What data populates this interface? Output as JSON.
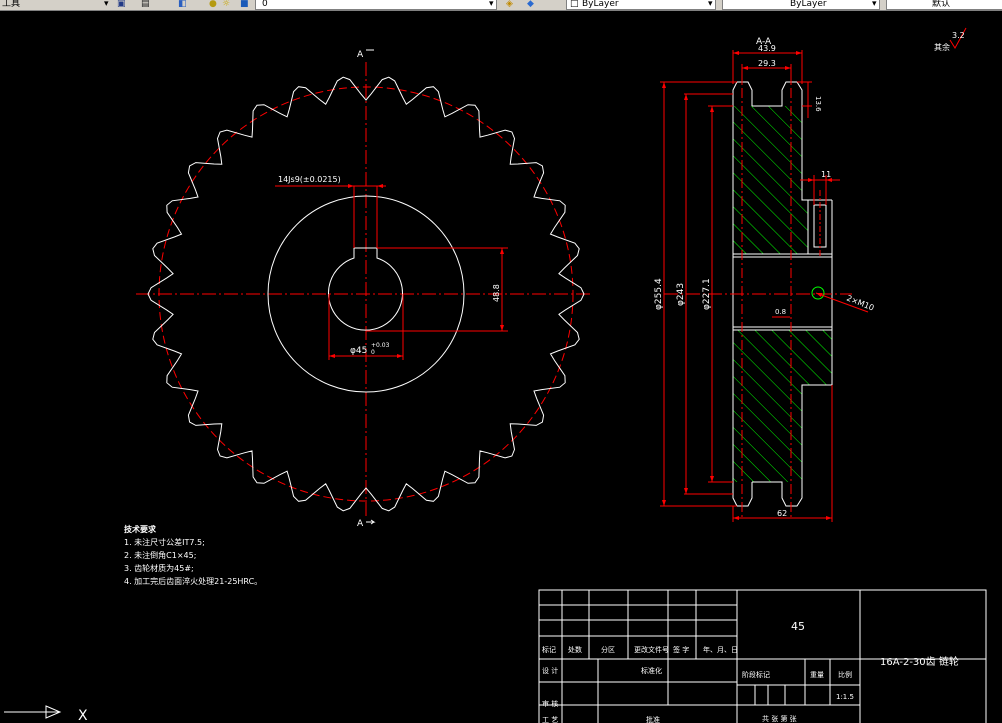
{
  "toolbar": {
    "workspace_label": "工具",
    "layer_value": "0",
    "color_value": "ByLayer",
    "linetype_value": "ByLayer",
    "lineweight_value": "默认"
  },
  "drawing": {
    "section_mark_top": "A",
    "section_mark_bottom": "A",
    "section_title": "A-A",
    "roughness_value": "3.2",
    "roughness_label": "其余",
    "dim_key_width": "14Js9(±0.0215)",
    "dim_bore": "φ45",
    "dim_bore_tol": "+0.03",
    "dim_bore_tol_lower": "0",
    "dim_keyway_depth": "48.8",
    "dim_hub_total": "43.9",
    "dim_tooth_span": "29.3",
    "dim_tooth_width": "13.6",
    "dim_hole_width": "11",
    "dim_outer_dia": "φ255.4",
    "dim_pitch_dia": "φ243",
    "dim_root_dia": "φ227.1",
    "dim_chamfer": "0.8",
    "dim_thread": "2×M10",
    "dim_length": "62"
  },
  "technical_requirements": {
    "title": "技术要求",
    "items": [
      "1. 未注尺寸公差IT7.5;",
      "2. 未注倒角C1×45;",
      "3. 齿轮材质为45#;",
      "4. 加工完后齿面淬火处理21-25HRC。"
    ]
  },
  "title_block": {
    "material": "45",
    "part_name": "16A-2-30齿 链轮",
    "row_labels": [
      "标记",
      "处数",
      "分区",
      "更改文件号",
      "签 字",
      "年、月、日"
    ],
    "design_label": "设 计",
    "standardize_label": "标准化",
    "review_label": "审 核",
    "process_label": "工 艺",
    "approve_label": "批准",
    "stage_label": "阶段标记",
    "weight_label": "重量",
    "scale_label": "比例",
    "scale_value": "1:1.5",
    "sheets_label": "共  张  第  张"
  },
  "ucs": {
    "x_label": "X"
  }
}
